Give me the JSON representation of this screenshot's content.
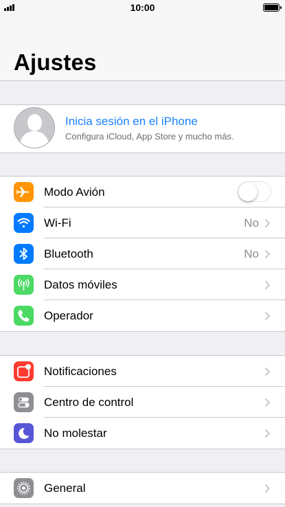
{
  "status_bar": {
    "time": "10:00"
  },
  "nav": {
    "title": "Ajustes"
  },
  "profile": {
    "title": "Inicia sesión en el iPhone",
    "subtitle": "Configura iCloud, App Store y mucho más."
  },
  "colors": {
    "airplane": "#ff9500",
    "wifi": "#007aff",
    "bluetooth": "#007aff",
    "cellular": "#4cd964",
    "carrier": "#4cd964",
    "notifications": "#ff3b30",
    "control_center": "#8e8e93",
    "dnd": "#5856d6",
    "general": "#8e8e93",
    "link": "#1a82fb"
  },
  "group1": [
    {
      "label": "Modo Avión",
      "icon": "airplane-icon",
      "toggle": false
    },
    {
      "label": "Wi-Fi",
      "icon": "wifi-icon",
      "value": "No"
    },
    {
      "label": "Bluetooth",
      "icon": "bluetooth-icon",
      "value": "No"
    },
    {
      "label": "Datos móviles",
      "icon": "cellular-antenna-icon"
    },
    {
      "label": "Operador",
      "icon": "phone-icon"
    }
  ],
  "group2": [
    {
      "label": "Notificaciones",
      "icon": "notifications-icon"
    },
    {
      "label": "Centro de control",
      "icon": "control-center-icon"
    },
    {
      "label": "No molestar",
      "icon": "moon-icon"
    }
  ],
  "group3": [
    {
      "label": "General",
      "icon": "gear-icon"
    }
  ]
}
